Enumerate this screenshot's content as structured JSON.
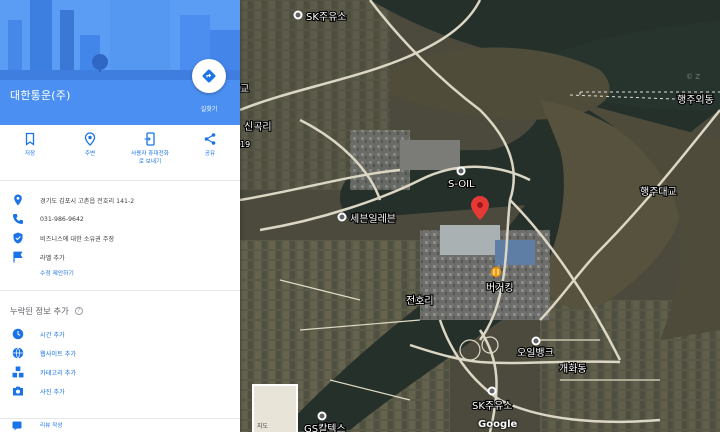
{
  "place": {
    "name": "대한통운(주)",
    "directions_label": "길찾기"
  },
  "actions": [
    {
      "icon": "bookmark-icon",
      "label": "저장"
    },
    {
      "icon": "nearby-icon",
      "label": "주변"
    },
    {
      "icon": "send-to-phone-icon",
      "label": "사용자 휴대전화\n로 보내기"
    },
    {
      "icon": "share-icon",
      "label": "공유"
    }
  ],
  "info": {
    "address": "경기도 김포시 고촌읍 전호리 141-2",
    "phone": "031-986-9642",
    "claim": "비즈니스에 대한 소유권 주장",
    "add_label": "라벨 추가",
    "suggest_edit": "수정 제안하기"
  },
  "missing": {
    "title": "누락된 정보 추가",
    "help_icon": "help-icon",
    "items": [
      {
        "icon": "clock-icon",
        "label": "시간 추가"
      },
      {
        "icon": "globe-icon",
        "label": "웹사이트 추가"
      },
      {
        "icon": "category-icon",
        "label": "카테고리 추가"
      },
      {
        "icon": "camera-icon",
        "label": "사진 추가"
      }
    ],
    "review_label": "리뷰 작성"
  },
  "map": {
    "labels": {
      "sk_top": "SK주유소",
      "gyo": "교",
      "singok": "신곡리",
      "num19": "19",
      "haengju_top": "행주외동",
      "soil": "S-OIL",
      "sebit": "세븐일레븐",
      "haengju_bridge": "행주대교",
      "jeonhori": "전호리",
      "burgerking": "버거킹",
      "ojeong": "오일뱅크",
      "gaehwa": "개화동",
      "sk_bottom": "SK주유소",
      "gs": "GS칼텍스",
      "watermark": "© Z"
    },
    "minimap_label": "지도",
    "google_label": "Google",
    "colors": {
      "river": "#25302a",
      "land": "#4a4a3e",
      "road": "#dcd7c4",
      "pin": "#e53935",
      "accent": "#1a73e8",
      "hero": "#4a8ff1"
    }
  }
}
